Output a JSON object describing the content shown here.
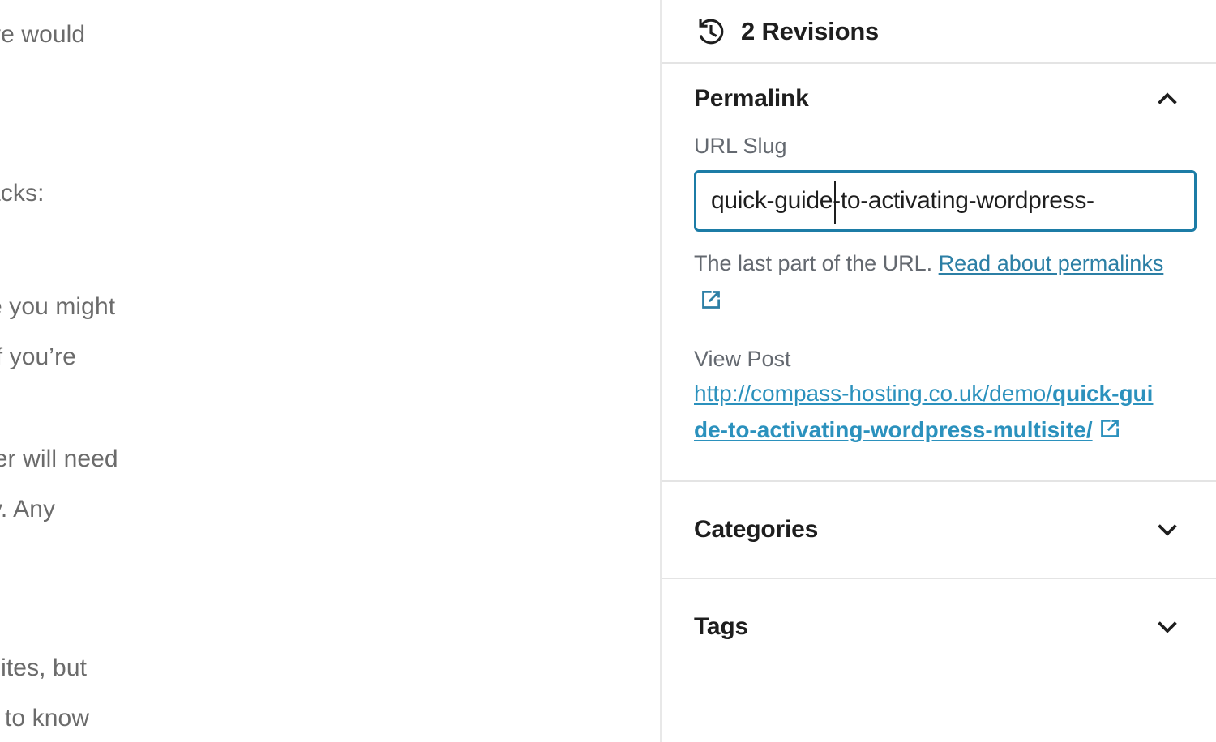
{
  "editor": {
    "visible_text_fragments": [
      "ve would",
      "acks:",
      "e you might",
      "if you’re",
      "ler will need",
      "y. Any",
      "sites, but",
      "to know"
    ]
  },
  "sidebar": {
    "revisions": {
      "label": "2 Revisions",
      "count": 2,
      "icon": "revision-clock-icon"
    },
    "permalink": {
      "title": "Permalink",
      "expanded": true,
      "toggle_icon": "chevron-up-icon",
      "url_slug": {
        "label": "URL Slug",
        "value": "quick-guide-to-activating-wordpress-",
        "placeholder": "quick-guide-to-activating-wordpress-multisite",
        "focused": true,
        "caret_after": "quick-guid"
      },
      "help": {
        "text": "The last part of the URL.",
        "link_label": "Read about permalinks",
        "link_icon": "external-link-icon"
      },
      "view_post": {
        "label": "View Post",
        "url_base": "http://compass-hosting.co.uk/demo/",
        "url_slug": "quick-guide-to-activating-wordpress-multisite/",
        "link_icon": "external-link-icon"
      }
    },
    "categories": {
      "title": "Categories",
      "expanded": false,
      "toggle_icon": "chevron-down-icon"
    },
    "tags": {
      "title": "Tags",
      "expanded": false,
      "toggle_icon": "chevron-down-icon"
    }
  },
  "colors": {
    "accent_focus_border": "#1c7ca6",
    "link": "#2c7fa5",
    "view_post_link": "#2b91bd",
    "label_gray": "#646970",
    "heading": "#1e1e1e",
    "divider": "#e4e4e4",
    "editor_text": "#6b6b6b"
  }
}
